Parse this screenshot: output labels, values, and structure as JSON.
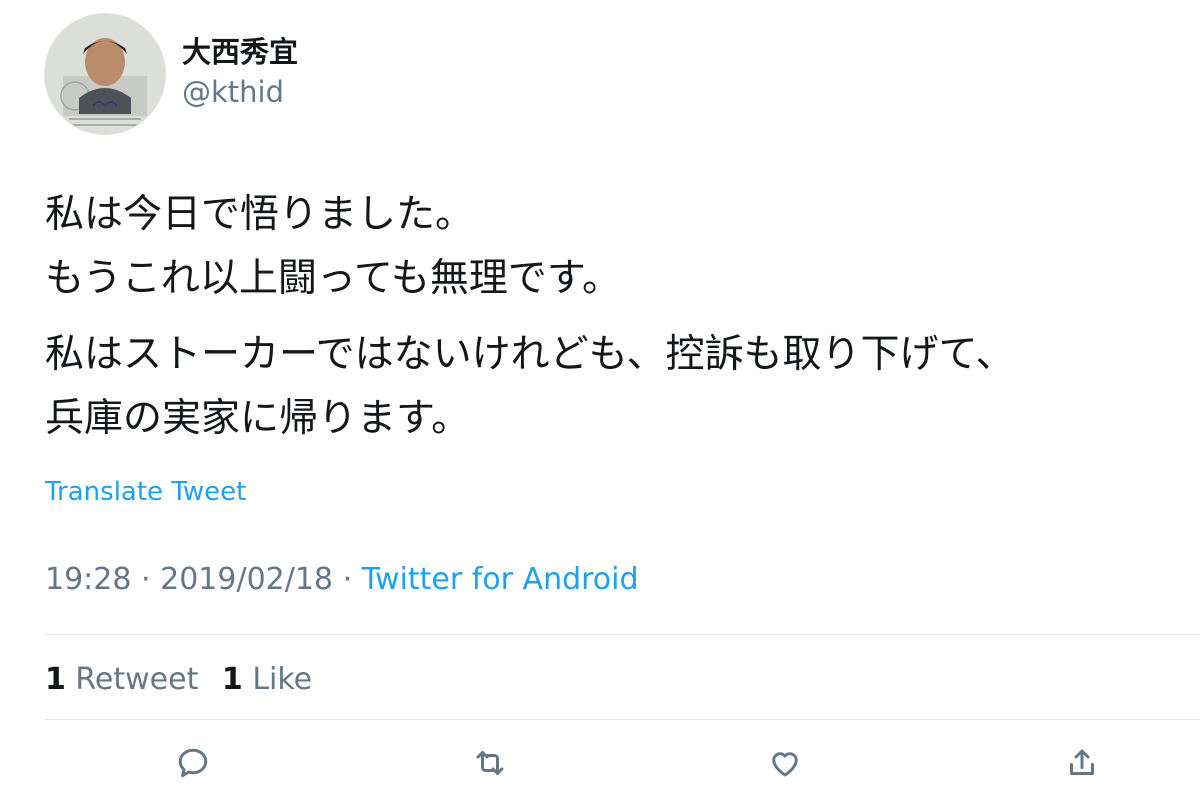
{
  "user": {
    "display_name": "大西秀宜",
    "handle": "@kthid"
  },
  "tweet": {
    "paragraphs": [
      [
        "私は今日で悟りました。",
        "もうこれ以上闘っても無理です。"
      ],
      [
        "私はストーカーではないけれども、控訴も取り下げて、",
        "兵庫の実家に帰ります。"
      ]
    ],
    "translate_label": "Translate Tweet",
    "time": "19:28",
    "date": "2019/02/18",
    "separator": "·",
    "source": "Twitter for Android"
  },
  "stats": {
    "retweet_count": "1",
    "retweet_label": "Retweet",
    "like_count": "1",
    "like_label": "Like"
  },
  "actions": {
    "icons": [
      "reply-icon",
      "retweet-icon",
      "like-icon",
      "share-icon"
    ]
  },
  "colors": {
    "link": "#1da1f2",
    "secondary_text": "#657786",
    "primary_text": "#14171a",
    "divider": "#e1e8ed"
  }
}
